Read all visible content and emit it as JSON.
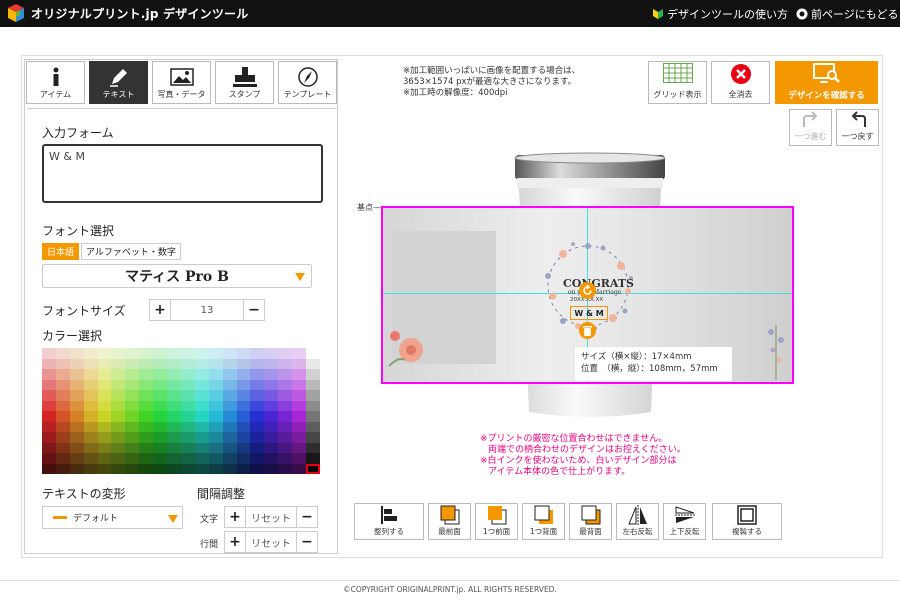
{
  "header": {
    "logo_text": "オリジナルプリント.jp デザインツール",
    "howto_link": "デザインツールの使い方",
    "back_link": "前ページにもどる"
  },
  "tabs": [
    {
      "label": "アイテム",
      "icon": "info-icon"
    },
    {
      "label": "テキスト",
      "icon": "pen-icon",
      "active": true
    },
    {
      "label": "写真・データ",
      "icon": "image-icon"
    },
    {
      "label": "スタンプ",
      "icon": "stamp-icon"
    },
    {
      "label": "テンプレート",
      "icon": "compass-icon"
    }
  ],
  "text_panel": {
    "input_form_title": "入力フォーム",
    "input_value": "W & M",
    "font_select_title": "フォント選択",
    "lang_japanese": "日本語",
    "lang_alphabet": "アルファベット・数字",
    "font_name": "マティス Pro B",
    "font_size_title": "フォントサイズ",
    "font_size_value": "13",
    "color_title": "カラー選択",
    "transform_title": "テキストの変形",
    "transform_value": "デフォルト",
    "spacing_title": "間隔調整",
    "char_spacing_label": "文字",
    "line_spacing_label": "行間",
    "reset_label": "リセット"
  },
  "notes": {
    "line1": "※加工範囲いっぱいに画像を配置する場合は、",
    "line2": "3653×1574 pxが最適な大きさになります。",
    "line3": "※加工時の解像度：400dpi"
  },
  "top_buttons": {
    "grid": "グリッド表示",
    "clear_all": "全消去",
    "confirm": "デザインを確認する",
    "redo": "一つ進む",
    "undo": "一つ戻す"
  },
  "canvas": {
    "start_label": "基点",
    "wreath_title": "CONGRATS",
    "wreath_sub": "on your Marriage",
    "wreath_year": "20XX.XX.XX",
    "selected_text": "W & M",
    "info_size": "サイズ（横×縦）：17×4mm",
    "info_pos": "位置　（横，縦）：108mm，57mm"
  },
  "warnings": {
    "line1": "※プリントの厳密な位置合わせはできません。",
    "line2": "両端での柄合わせのデザインはお控えください。",
    "line3": "※白インクを使わないため、白いデザイン部分は",
    "line4": "アイテム本体の色で仕上がります。"
  },
  "bottom_toolbar": [
    {
      "label": "整列する",
      "icon": "align-icon"
    },
    {
      "label": "最前面",
      "icon": "bring-front-icon"
    },
    {
      "label": "1つ前面",
      "icon": "bring-forward-icon"
    },
    {
      "label": "1つ背面",
      "icon": "send-backward-icon"
    },
    {
      "label": "最背面",
      "icon": "send-back-icon"
    },
    {
      "label": "左右反転",
      "icon": "flip-horizontal-icon"
    },
    {
      "label": "上下反転",
      "icon": "flip-vertical-icon"
    },
    {
      "label": "複製する",
      "icon": "duplicate-icon"
    }
  ],
  "footer": "©COPYRIGHT ORIGINALPRINT.jp. ALL RIGHTS RESERVED.",
  "colors": {
    "accent": "#f39800",
    "selection": "#ff00ff",
    "warning_text": "#e4007f",
    "header_bg": "#111111"
  }
}
